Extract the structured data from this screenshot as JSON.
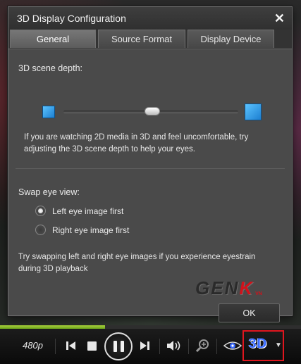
{
  "dialog": {
    "title": "3D Display Configuration",
    "close_glyph": "✕",
    "tabs": [
      {
        "label": "General",
        "active": true
      },
      {
        "label": "Source Format",
        "active": false
      },
      {
        "label": "Display Device",
        "active": false
      }
    ]
  },
  "general": {
    "depth_label": "3D scene depth:",
    "depth_slider_value": 0.51,
    "depth_help": "If you are watching 2D media in 3D and feel uncomfortable, try adjusting the 3D scene depth to help your eyes.",
    "swap_label": "Swap eye view:",
    "options": [
      {
        "label": "Left eye image first",
        "selected": true
      },
      {
        "label": "Right eye image first",
        "selected": false
      }
    ],
    "swap_help": "Try swapping left and right eye images if you experience eyestrain during 3D playback",
    "ok_label": "OK"
  },
  "watermark": {
    "text_main": "GEN",
    "text_accent": "K",
    "suffix": "VN"
  },
  "player": {
    "resolution": "480p",
    "progress": 0.35,
    "three_d_label": "3D",
    "accent_color": "#a9d23b",
    "highlight_color": "#e0161e",
    "icons": [
      "skip-back-icon",
      "stop-icon",
      "pause-icon",
      "skip-forward-icon",
      "volume-icon",
      "zoom-icon",
      "eye-3d-icon",
      "three-d-icon",
      "chevron-down-icon"
    ]
  }
}
